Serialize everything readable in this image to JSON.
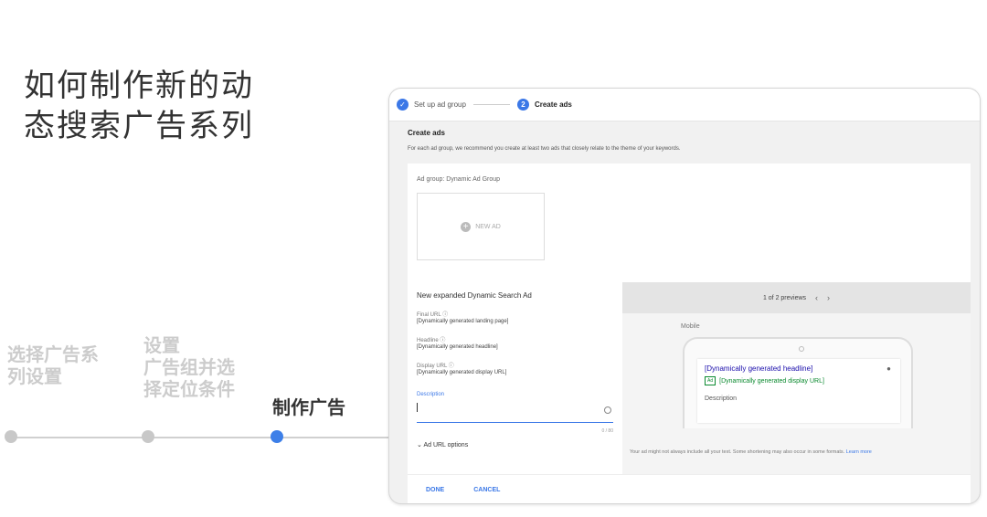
{
  "slide": {
    "title_line1": "如何制作新的动",
    "title_line2": "态搜索广告系列",
    "steps": [
      {
        "line1": "选择广告系",
        "line2": "列设置"
      },
      {
        "line1": "设置",
        "line2": "广告组并选",
        "line3": "择定位条件"
      },
      {
        "line1": "制作广告"
      }
    ]
  },
  "stepper": {
    "step1_label": "Set up ad group",
    "step1_icon": "check-icon",
    "step2_number": "2",
    "step2_label": "Create ads"
  },
  "create": {
    "header": "Create ads",
    "subtitle": "For each ad group, we recommend you create at least two ads that closely relate to the theme of your keywords."
  },
  "ad_group": {
    "label": "Ad group: Dynamic Ad Group",
    "new_ad": "NEW AD"
  },
  "form": {
    "title": "New expanded Dynamic Search Ad",
    "final_url_label": "Final URL",
    "final_url_value": "[Dynamically generated landing page]",
    "headline_label": "Headline",
    "headline_value": "[Dynamically generated headline]",
    "display_url_label": "Display URL",
    "display_url_value": "[Dynamically generated display URL]",
    "description_label": "Description",
    "char_count": "0 / 80",
    "ad_url_options": "Ad URL options"
  },
  "preview": {
    "header": "1 of 2 previews",
    "prev_icon": "chevron-left-icon",
    "next_icon": "chevron-right-icon",
    "device_label": "Mobile",
    "ad_headline": "[Dynamically generated headline]",
    "ad_badge": "Ad",
    "ad_display_url": "[Dynamically generated display URL]",
    "ad_description": "Description",
    "note": "Your ad might not always include all your text. Some shortening may also occur in some formats.",
    "learn_more": "Learn more"
  },
  "actions": {
    "done": "DONE",
    "cancel": "CANCEL"
  },
  "colors": {
    "accent": "#3b78e7",
    "timeline_active": "#3d7fe8",
    "ad_headline": "#1a0dab",
    "ad_url": "#0b8a2f"
  }
}
